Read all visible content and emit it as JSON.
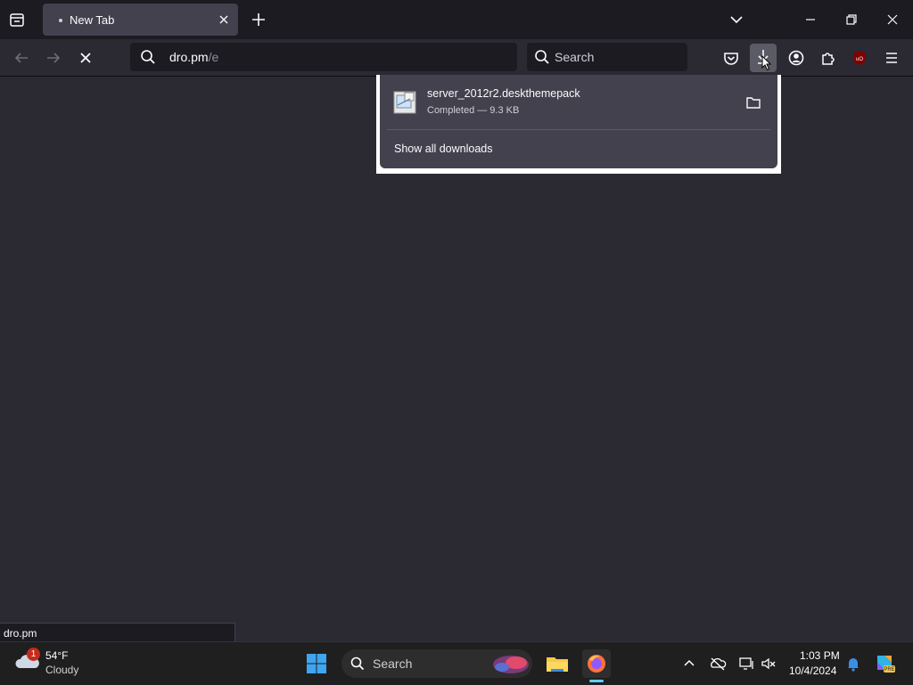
{
  "browser": {
    "tab": {
      "title": "New Tab"
    },
    "url": {
      "host": "dro.pm",
      "path": "/e"
    },
    "search_placeholder": "Search",
    "downloads_panel": {
      "item_name": "server_2012r2.deskthemepack",
      "item_status": "Completed — 9.3 KB",
      "show_all": "Show all downloads"
    },
    "status_text": "dro.pm"
  },
  "taskbar": {
    "weather": {
      "temp": "54°F",
      "condition": "Cloudy",
      "badge": "1"
    },
    "search_label": "Search",
    "clock": {
      "time": "1:03 PM",
      "date": "10/4/2024"
    }
  },
  "colors": {
    "accent": "#60cdff",
    "ublock": "#800000",
    "page_bg": "#2b2a33"
  }
}
